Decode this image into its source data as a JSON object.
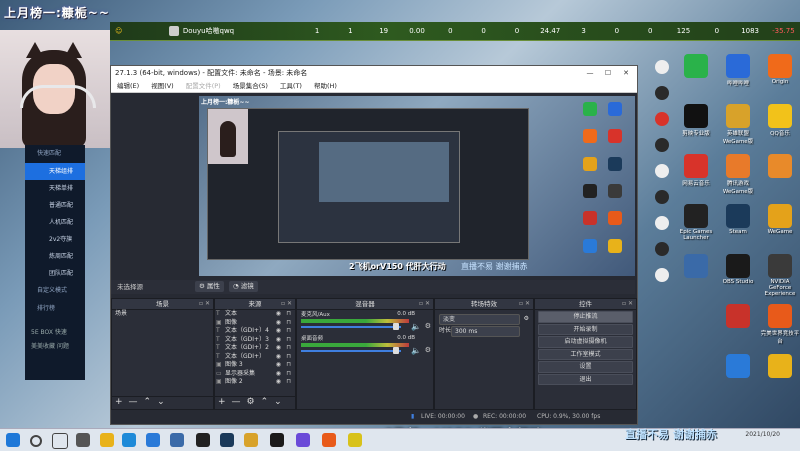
{
  "overlay": {
    "title": "上月榜一:糠栀~~",
    "bottom_text": "2飞机orV150 代肝大行动",
    "bottom_text2": "直播不易 谢谢捕赤"
  },
  "topbar": {
    "user": "Douyu哈嗷qwq",
    "stats": [
      "1",
      "1",
      "19",
      "0.00",
      "0",
      "0",
      "0",
      "24.47",
      "3",
      "0",
      "0",
      "125",
      "0",
      "1083",
      "-35.75"
    ],
    "negative_color": "#ff5a5a"
  },
  "left_panel": {
    "header": "快速匹配",
    "items": [
      "天梯组排",
      "天梯单排",
      "普通匹配",
      "人机匹配",
      "2v2夺旗",
      "炼周匹配",
      "团队匹配"
    ],
    "active_index": 0,
    "custom_mode": "自定义模式",
    "friends": "排行榜",
    "bottom_a": "5E BOX",
    "bottom_b": "快速",
    "bottom_c": "美美收藏",
    "bottom_d": "问题"
  },
  "obs": {
    "title": "27.1.3 (64-bit, windows) - 配置文件: 未命名 - 场景: 未命名",
    "menu": [
      "编辑(E)",
      "视图(V)",
      "配置文件(P)",
      "场景集合(S)",
      "工具(T)",
      "帮助(H)"
    ],
    "menu_dim_index": 2,
    "no_source": "未选择源",
    "btn_props": "属性",
    "btn_filters": "滤镜",
    "docks": {
      "scenes": "场景",
      "sources": "来源",
      "mixer": "混音器",
      "transitions": "转场特效",
      "controls": "控件"
    },
    "scenes": [
      "场景"
    ],
    "sources": [
      {
        "type": "T",
        "name": "文本"
      },
      {
        "type": "▣",
        "name": "图像"
      },
      {
        "type": "T",
        "name": "文本（GDI+）4"
      },
      {
        "type": "T",
        "name": "文本（GDI+）3"
      },
      {
        "type": "T",
        "name": "文本（GDI+）2"
      },
      {
        "type": "T",
        "name": "文本（GDI+）"
      },
      {
        "type": "▣",
        "name": "图像 3"
      },
      {
        "type": "▭",
        "name": "显示器采集"
      },
      {
        "type": "▣",
        "name": "图像 2"
      }
    ],
    "mixer_tracks": [
      {
        "name": "麦克风/Aux",
        "db": "0.0 dB"
      },
      {
        "name": "桌面音频",
        "db": "0.0 dB"
      }
    ],
    "transition_type": "淡变",
    "duration_label": "时长",
    "duration_value": "300 ms",
    "controls": [
      "停止推流",
      "开始录制",
      "启动虚拟摄像机",
      "工作室模式",
      "设置",
      "退出"
    ],
    "controls_highlight": 0,
    "status": {
      "live": "LIVE: 00:00:00",
      "rec": "REC: 00:00:00",
      "cpu": "CPU: 0.9%, 30.00 fps"
    }
  },
  "desktop_icons": [
    {
      "label": "",
      "color": "#2ab24a",
      "col": 0,
      "row": 0
    },
    {
      "label": "哔哩哔哩",
      "color": "#2a6ad8",
      "col": 1,
      "row": 0
    },
    {
      "label": "Origin",
      "color": "#f06a1a",
      "col": 2,
      "row": 0
    },
    {
      "label": "剪映专业版",
      "color": "#111111",
      "col": 0,
      "row": 1
    },
    {
      "label": "英雄联盟WeGame版",
      "color": "#d8a22a",
      "col": 1,
      "row": 1
    },
    {
      "label": "QQ音乐",
      "color": "#f2c21a",
      "col": 2,
      "row": 1
    },
    {
      "label": "网易云音乐",
      "color": "#d8332a",
      "col": 0,
      "row": 2
    },
    {
      "label": "腾讯游戏 WeGame版",
      "color": "#e87a2a",
      "col": 1,
      "row": 2
    },
    {
      "label": "",
      "color": "#e88a2a",
      "col": 2,
      "row": 2
    },
    {
      "label": "Epic Games Launcher",
      "color": "#222222",
      "col": 0,
      "row": 3
    },
    {
      "label": "Steam",
      "color": "#1b3a5a",
      "col": 1,
      "row": 3
    },
    {
      "label": "WeGame",
      "color": "#e4a21a",
      "col": 2,
      "row": 3
    },
    {
      "label": "",
      "color": "#3a6aa8",
      "col": 0,
      "row": 4
    },
    {
      "label": "OBS Studio",
      "color": "#1a1a1a",
      "col": 1,
      "row": 4
    },
    {
      "label": "NVIDIA GeForce Experience",
      "color": "#3a3a3a",
      "col": 2,
      "row": 4
    },
    {
      "label": "",
      "color": "#c8322a",
      "col": 1,
      "row": 5
    },
    {
      "label": "完美世界竞技平台",
      "color": "#e85a1a",
      "col": 2,
      "row": 5
    },
    {
      "label": "",
      "color": "#2a7ad8",
      "col": 1,
      "row": 6
    },
    {
      "label": "",
      "color": "#e8b21a",
      "col": 2,
      "row": 6
    }
  ],
  "taskbar": {
    "time": "",
    "date": "2021/10/20"
  }
}
